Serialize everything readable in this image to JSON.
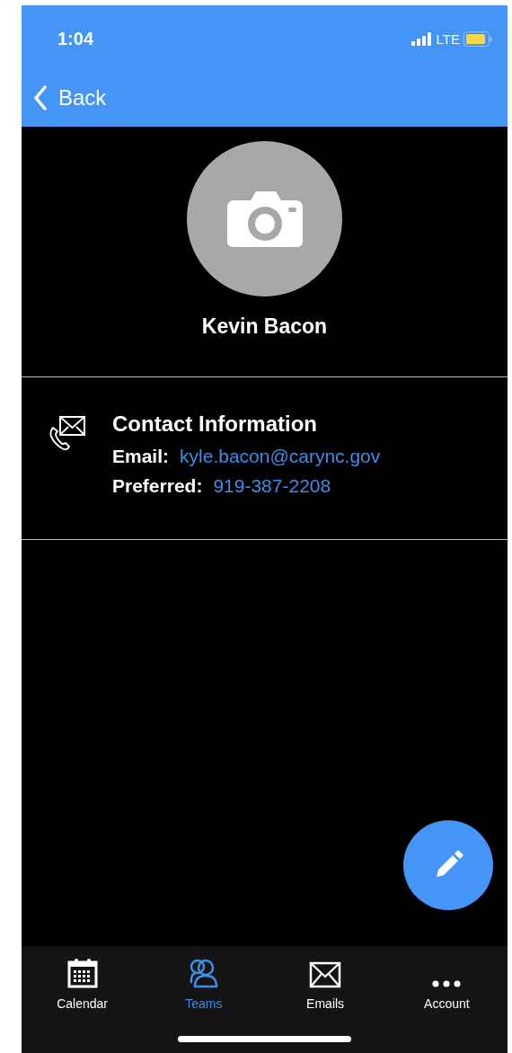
{
  "status_bar": {
    "time": "1:04",
    "network": "LTE"
  },
  "nav": {
    "back": "Back"
  },
  "profile": {
    "name": "Kevin Bacon"
  },
  "contact": {
    "title": "Contact Information",
    "fields": [
      {
        "label": "Email:",
        "value": "kyle.bacon@carync.gov"
      },
      {
        "label": "Preferred:",
        "value": "919-387-2208"
      }
    ]
  },
  "tabs": [
    {
      "kind": "calendar",
      "label": "Calendar",
      "selected": false
    },
    {
      "kind": "teams",
      "label": "Teams",
      "selected": true
    },
    {
      "kind": "emails",
      "label": "Emails",
      "selected": false
    },
    {
      "kind": "more",
      "label": "Account",
      "selected": false
    }
  ]
}
